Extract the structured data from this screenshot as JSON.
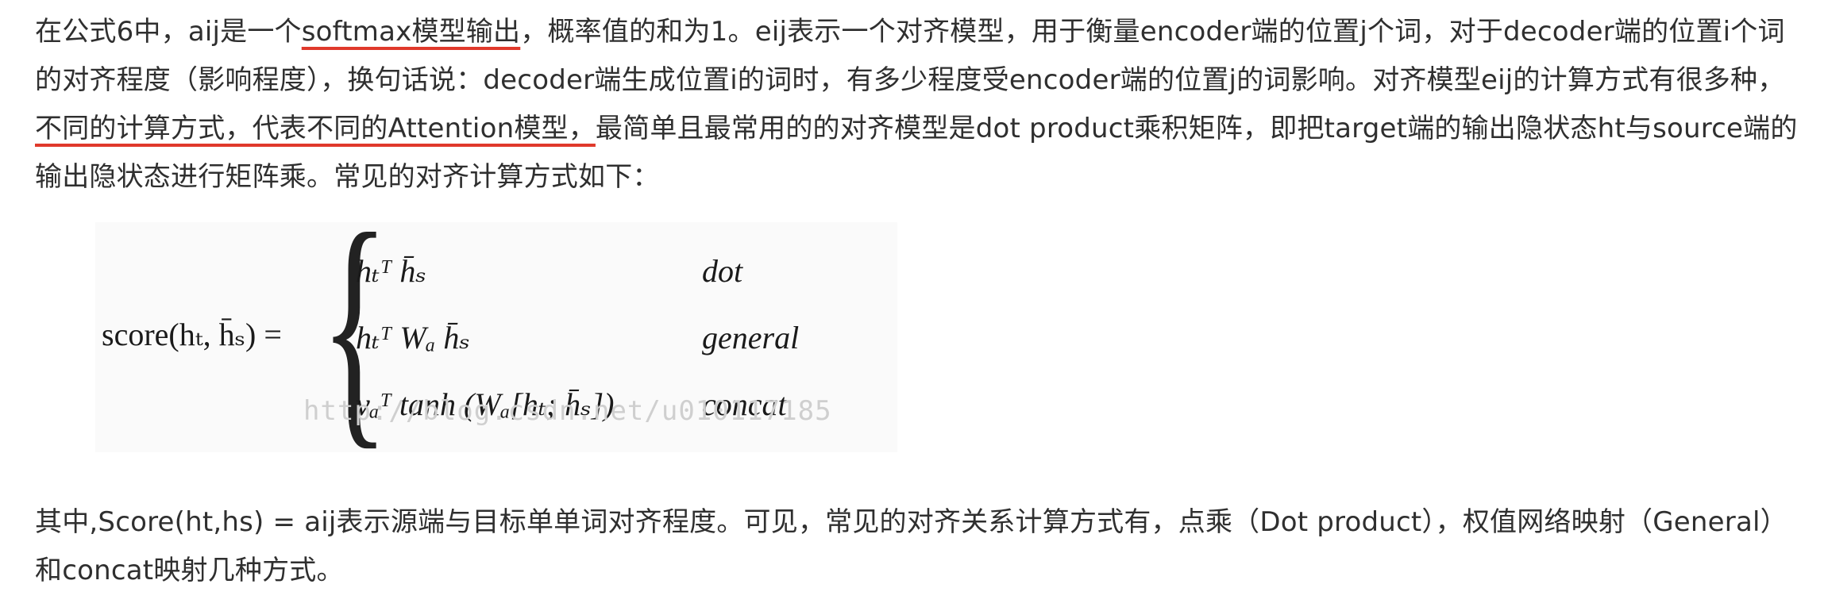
{
  "para1": {
    "s1": "在公式6中，aij是一个",
    "u1": "softmax模型输出",
    "s2": "，概率值的和为1。eij表示一个对齐模型，用于衡量encoder端的位置j个词，对于decoder端的位置i个词的对齐程度（影响程度），换句话说：decoder端生成位置i的词时，有多少程度受encoder端的位置j的词影响。对齐模型eij的计算方式有很多种，",
    "u2": "不同的计算方式，代表不同的Attention模型，",
    "s3": "最简单且最常用的的对齐模型是dot product乘积矩阵，即把target端的输出隐状态ht与source端的输出隐状态进行矩阵乘。常见的对齐计算方式如下："
  },
  "formula": {
    "lhs": "score(hₜ, h̄ₛ) =",
    "rows": [
      {
        "expr": "hₜᵀ h̄ₛ",
        "label": "dot"
      },
      {
        "expr": "hₜᵀ Wₐ h̄ₛ",
        "label": "general"
      },
      {
        "expr": "vₐᵀ tanh (Wₐ[hₜ; h̄ₛ])",
        "label": "concat"
      }
    ],
    "watermark": "http://blog.csdn.net/u010117185"
  },
  "para2": {
    "text": "其中,Score(ht,hs) = aij表示源端与目标单单词对齐程度。可见，常见的对齐关系计算方式有，点乘（Dot product），权值网络映射（General）和concat映射几种方式。"
  }
}
